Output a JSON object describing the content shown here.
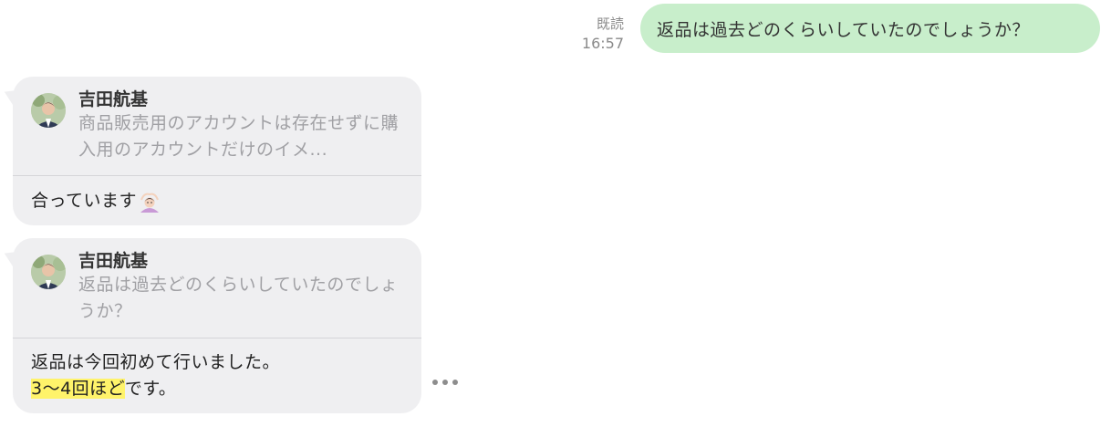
{
  "outgoing": {
    "status": "既読",
    "time": "16:57",
    "text": "返品は過去どのくらいしていたのでしょうか？"
  },
  "replies": [
    {
      "quote_author": "吉田航基",
      "quote_text": "商品販売用のアカウントは存在せずに購入用のアカウントだけのイメ...",
      "body_line1": "合っています",
      "emoji_icon": "person-gesturing-ok-icon"
    },
    {
      "quote_author": "吉田航基",
      "quote_text": "返品は過去どのくらいしていたのでしょうか？",
      "body_line1": "返品は今回初めて行いました。",
      "body_highlight": "3〜4回ほど",
      "body_rest": "です。"
    }
  ],
  "colors": {
    "outgoing_bubble": "#c8eecb",
    "incoming_bubble": "#efeff1",
    "highlight": "#fff36a"
  },
  "typing_indicator_icon": "ellipsis-icon"
}
